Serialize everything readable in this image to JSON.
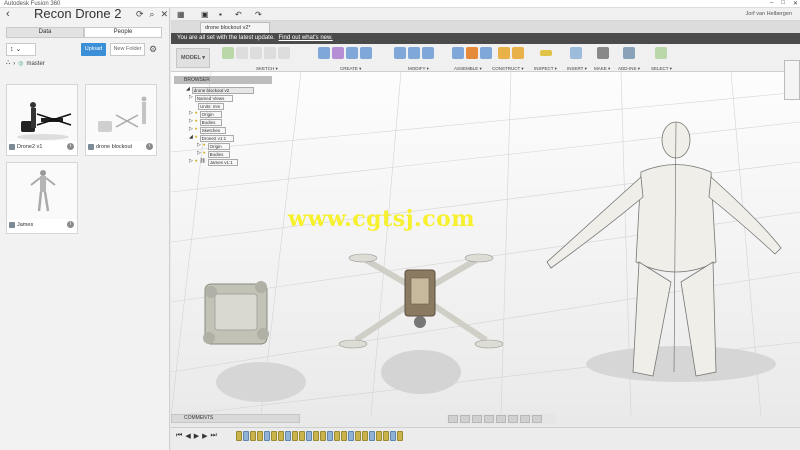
{
  "window": {
    "title": "Autodesk Fusion 360",
    "user": "Jorf van Helbergen"
  },
  "data_panel": {
    "project": "Recon Drone 2",
    "tabs": [
      "Data",
      "People"
    ],
    "upload_label": "Upload",
    "new_folder_label": "New Folder",
    "branch": "master",
    "items": [
      {
        "name": "Drone2 v1"
      },
      {
        "name": "drone blockout"
      },
      {
        "name": "James"
      }
    ]
  },
  "document_tab": "drone blockout v2*",
  "banner": {
    "text": "You are all set with the latest update.",
    "link": "Find out what's new."
  },
  "toolbar": {
    "workspace": "MODEL ▾",
    "groups": [
      "SKETCH ▾",
      "CREATE ▾",
      "MODIFY ▾",
      "ASSEMBLE ▾",
      "CONSTRUCT ▾",
      "INSPECT ▾",
      "INSERT ▾",
      "MAKE ▾",
      "ADD-INS ▾",
      "SELECT ▾"
    ]
  },
  "browser": {
    "title": "BROWSER",
    "rows": [
      "drone blockout v2",
      "Named Views",
      "Units: mm",
      "Origin",
      "Bodies",
      "Sketches",
      "Drone2 v1:1",
      "Origin",
      "Bodies",
      "James v1:1"
    ]
  },
  "watermark": "www.cgtsj.com",
  "comments_label": "COMMENTS",
  "colors": {
    "banner": "#4b4b4b",
    "upload": "#3a8fd6",
    "watermark": "#f6f02d"
  }
}
